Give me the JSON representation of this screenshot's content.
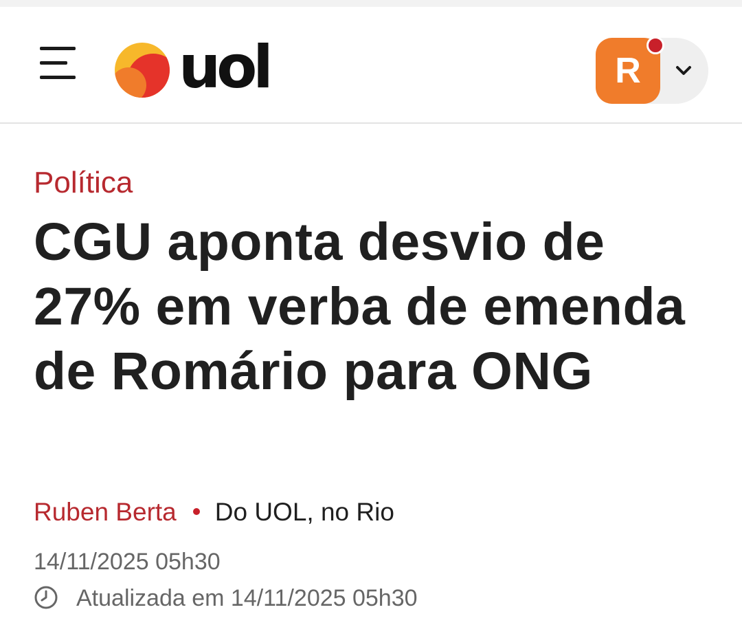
{
  "header": {
    "logo_text": "uol",
    "avatar_initial": "R",
    "menu_icon": "hamburger-menu-icon",
    "account_icon": "chevron-down-icon",
    "colors": {
      "avatar_bg": "#f07c2b",
      "notification_dot": "#c8202a",
      "logo_sun_yellow": "#f7b82b",
      "logo_sun_red": "#e5332a"
    }
  },
  "article": {
    "category": "Política",
    "headline": "CGU aponta desvio de 27% em verba de emenda de Romário para ONG",
    "author": "Ruben Berta",
    "source": "Do UOL, no Rio",
    "published": "14/11/2025 05h30",
    "updated": "Atualizada em 14/11/2025 05h30",
    "colors": {
      "accent": "#b7292f",
      "headline_text": "#202020",
      "meta_text": "#666666"
    }
  }
}
